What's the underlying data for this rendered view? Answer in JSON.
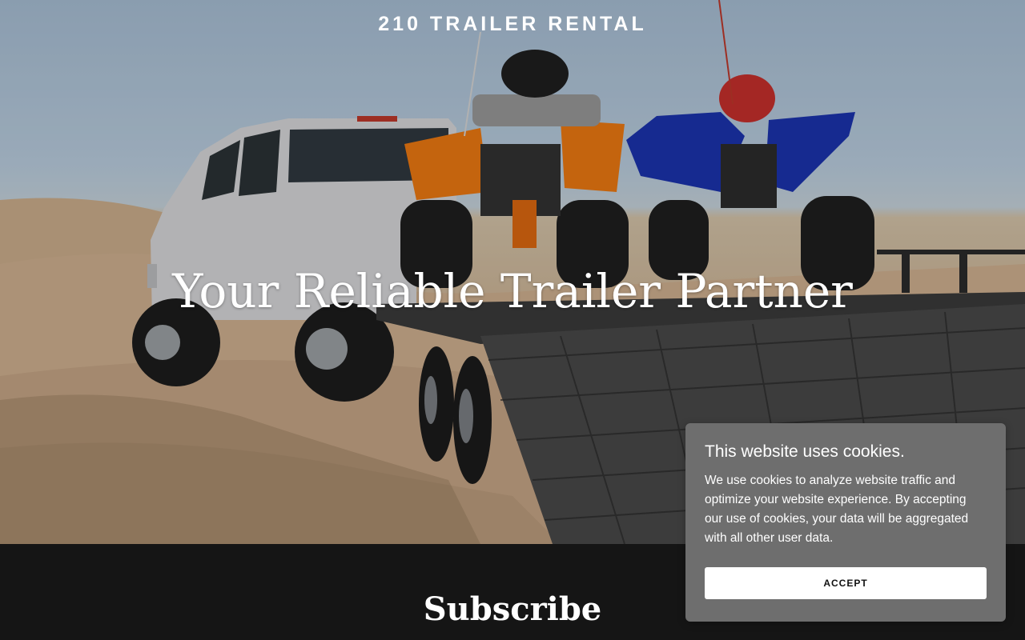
{
  "site": {
    "title": "210 TRAILER RENTAL"
  },
  "hero": {
    "heading": "Your Reliable Trailer Partner",
    "image_alt": "white pickup truck towing a trailer with two ATVs in sand dunes"
  },
  "subscribe": {
    "title": "Subscribe"
  },
  "cookie_banner": {
    "title": "This website uses cookies.",
    "text": "We use cookies to analyze website traffic and optimize your website experience. By accepting our use of cookies, your data will be aggregated with all other user data.",
    "accept_label": "ACCEPT"
  },
  "colors": {
    "footer_bg": "#151515",
    "cookie_bg": "#6e6e6e",
    "atv_orange": "#f07a12",
    "atv_blue": "#1c34b0"
  }
}
